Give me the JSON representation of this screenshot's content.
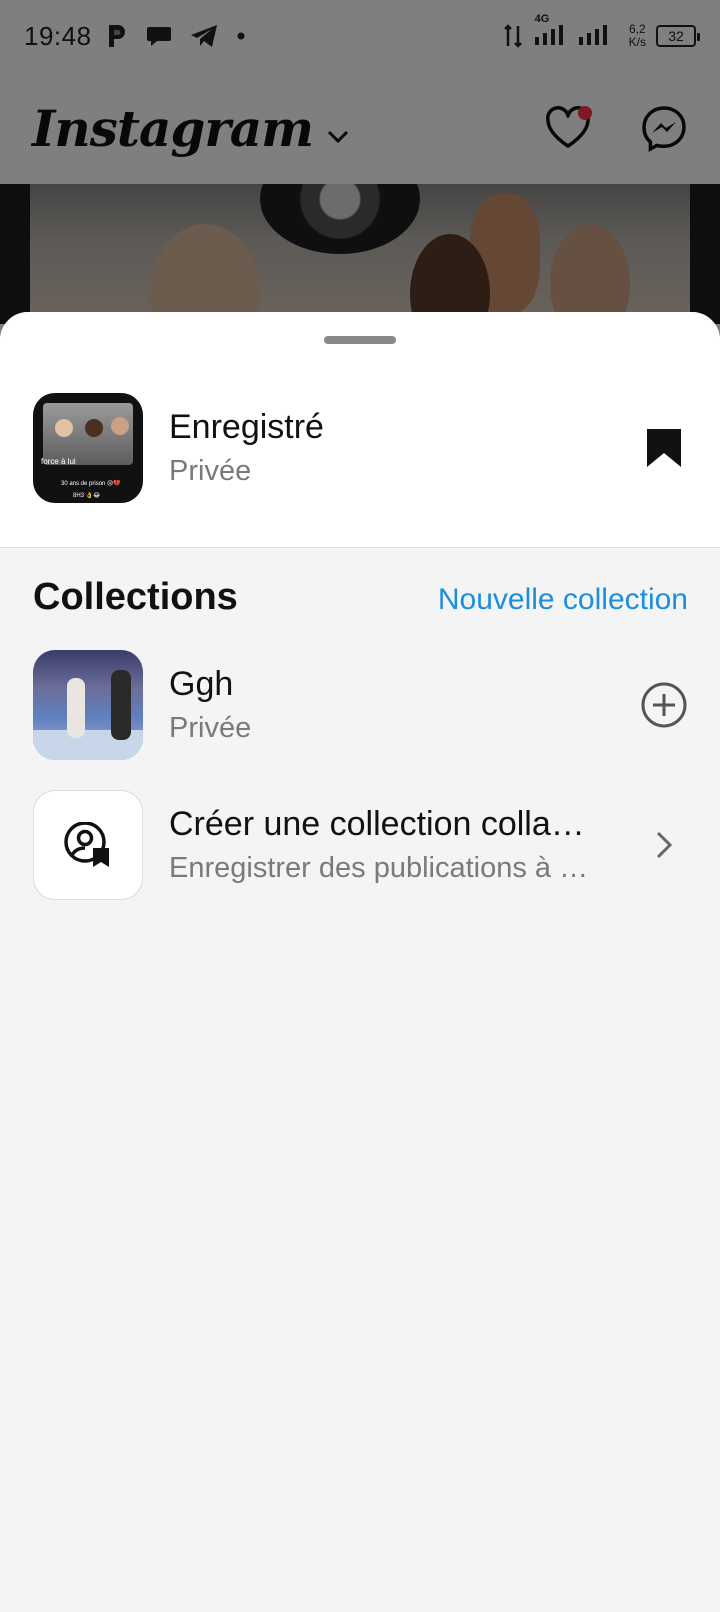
{
  "status_bar": {
    "time": "19:48",
    "left_icons": [
      "parking-icon",
      "chat-bubble-icon",
      "telegram-icon",
      "dot-icon"
    ],
    "network_type": "4G",
    "net_speed_value": "6,2",
    "net_speed_unit": "K/s",
    "battery": "32"
  },
  "header": {
    "logo": "Instagram",
    "icons": [
      "chevron-down-icon",
      "heart-icon",
      "messenger-icon"
    ]
  },
  "sheet": {
    "saved": {
      "title": "Enregistré",
      "subtitle": "Privée",
      "thumb_caption_1": "force à lui",
      "thumb_caption_2": "30 ans de prison 😢💔",
      "thumb_caption_3": "8H3 👌😂"
    },
    "collections": {
      "title": "Collections",
      "new_link": "Nouvelle collection",
      "items": [
        {
          "title": "Ggh",
          "subtitle": "Privée"
        }
      ],
      "collab": {
        "title": "Créer une collection colla…",
        "subtitle": "Enregistrer des publications à …"
      }
    }
  },
  "colors": {
    "link": "#1a8fdf",
    "notification": "#ff3040",
    "sheet_background": "#f4f4f4"
  }
}
